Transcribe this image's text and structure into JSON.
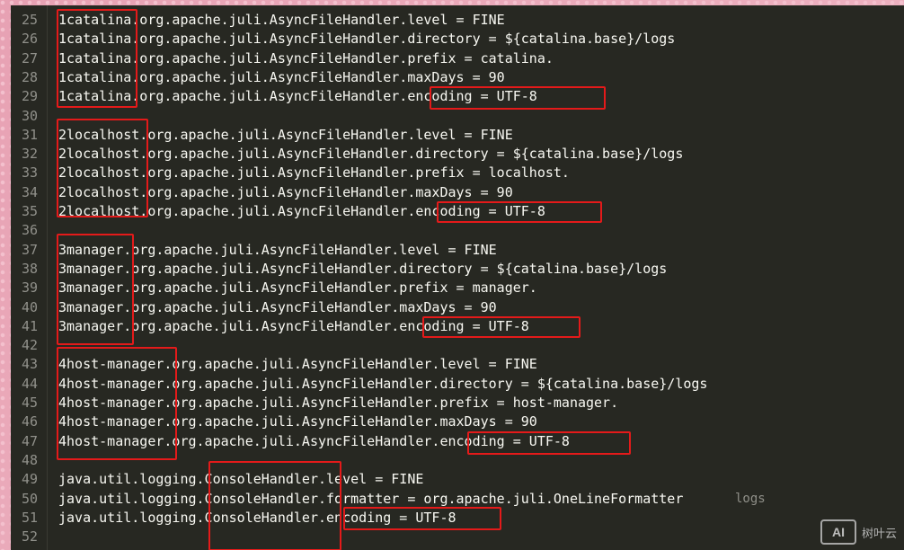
{
  "editor": {
    "lines": [
      {
        "n": "25",
        "t": "1catalina.org.apache.juli.AsyncFileHandler.level = FINE"
      },
      {
        "n": "26",
        "t": "1catalina.org.apache.juli.AsyncFileHandler.directory = ${catalina.base}/logs"
      },
      {
        "n": "27",
        "t": "1catalina.org.apache.juli.AsyncFileHandler.prefix = catalina."
      },
      {
        "n": "28",
        "t": "1catalina.org.apache.juli.AsyncFileHandler.maxDays = 90"
      },
      {
        "n": "29",
        "t": "1catalina.org.apache.juli.AsyncFileHandler.encoding = UTF-8"
      },
      {
        "n": "30",
        "t": ""
      },
      {
        "n": "31",
        "t": "2localhost.org.apache.juli.AsyncFileHandler.level = FINE"
      },
      {
        "n": "32",
        "t": "2localhost.org.apache.juli.AsyncFileHandler.directory = ${catalina.base}/logs"
      },
      {
        "n": "33",
        "t": "2localhost.org.apache.juli.AsyncFileHandler.prefix = localhost."
      },
      {
        "n": "34",
        "t": "2localhost.org.apache.juli.AsyncFileHandler.maxDays = 90"
      },
      {
        "n": "35",
        "t": "2localhost.org.apache.juli.AsyncFileHandler.encoding = UTF-8"
      },
      {
        "n": "36",
        "t": ""
      },
      {
        "n": "37",
        "t": "3manager.org.apache.juli.AsyncFileHandler.level = FINE"
      },
      {
        "n": "38",
        "t": "3manager.org.apache.juli.AsyncFileHandler.directory = ${catalina.base}/logs"
      },
      {
        "n": "39",
        "t": "3manager.org.apache.juli.AsyncFileHandler.prefix = manager."
      },
      {
        "n": "40",
        "t": "3manager.org.apache.juli.AsyncFileHandler.maxDays = 90"
      },
      {
        "n": "41",
        "t": "3manager.org.apache.juli.AsyncFileHandler.encoding = UTF-8"
      },
      {
        "n": "42",
        "t": ""
      },
      {
        "n": "43",
        "t": "4host-manager.org.apache.juli.AsyncFileHandler.level = FINE"
      },
      {
        "n": "44",
        "t": "4host-manager.org.apache.juli.AsyncFileHandler.directory = ${catalina.base}/logs"
      },
      {
        "n": "45",
        "t": "4host-manager.org.apache.juli.AsyncFileHandler.prefix = host-manager."
      },
      {
        "n": "46",
        "t": "4host-manager.org.apache.juli.AsyncFileHandler.maxDays = 90"
      },
      {
        "n": "47",
        "t": "4host-manager.org.apache.juli.AsyncFileHandler.encoding = UTF-8"
      },
      {
        "n": "48",
        "t": ""
      },
      {
        "n": "49",
        "t": "java.util.logging.ConsoleHandler.level = FINE"
      },
      {
        "n": "50",
        "t": "java.util.logging.ConsoleHandler.formatter = org.apache.juli.OneLineFormatter"
      },
      {
        "n": "51",
        "t": "java.util.logging.ConsoleHandler.encoding = UTF-8"
      },
      {
        "n": "52",
        "t": ""
      }
    ],
    "line50_tail": "logs"
  },
  "watermark": {
    "logo": "AI",
    "text": "树叶云"
  },
  "colors": {
    "editor_bg": "#272822",
    "text": "#f8f8f2",
    "gutter_text": "#90908a",
    "highlight_box": "#e41a1a",
    "frame": "#e8a6b6"
  }
}
